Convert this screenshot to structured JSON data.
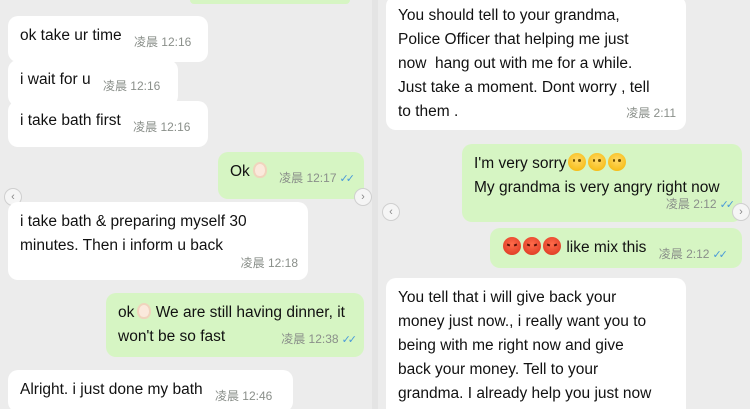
{
  "left_panel": {
    "messages": [
      {
        "text": "ok take ur time",
        "time": "凌晨 12:16",
        "dir": "in"
      },
      {
        "text": "i wait for u",
        "time": "凌晨 12:16",
        "dir": "in"
      },
      {
        "text": "i take bath first",
        "time": "凌晨 12:16",
        "dir": "in"
      },
      {
        "text": "Ok",
        "time": "凌晨 12:17",
        "dir": "out",
        "emoji": "ok-hand"
      },
      {
        "text": "i take bath & preparing myself 30\nminutes. Then i inform u back",
        "time": "凌晨 12:18",
        "dir": "in"
      },
      {
        "text_prefix": "ok",
        "text": "We are still having dinner, it\nwon't be so fast",
        "time": "凌晨 12:38",
        "dir": "out",
        "emoji": "ok-hand"
      },
      {
        "text": "Alright. i just done my bath",
        "time": "凌晨 12:46",
        "dir": "in"
      }
    ]
  },
  "right_panel": {
    "messages": [
      {
        "text": "You should tell to your grandma,\nPolice Officer that helping me just\nnow  hang out with me for a while.\nJust take a moment. Dont worry , tell\nto them .",
        "time": "凌晨 2:11",
        "dir": "in"
      },
      {
        "text_line1": "I'm very sorry",
        "text_line2": "My grandma is very angry right now",
        "time": "凌晨 2:12",
        "dir": "out",
        "emoji": "sad-face x3"
      },
      {
        "text": "like mix this",
        "time": "凌晨 2:12",
        "dir": "out",
        "emoji": "angry-face x3"
      },
      {
        "text": "You tell that i will give back your\nmoney just now., i really want you to\nbeing with me right now and give\nback your money. Tell to your\ngrandma. I already help you just now",
        "dir": "in"
      }
    ]
  },
  "colors": {
    "incoming_bubble": "#ffffff",
    "outgoing_bubble": "#d6f5c3",
    "read_ticks": "#4a9ad8",
    "background": "#ececec"
  },
  "read_ticks": "✓✓",
  "nav": {
    "prev": "‹",
    "next": "›"
  }
}
